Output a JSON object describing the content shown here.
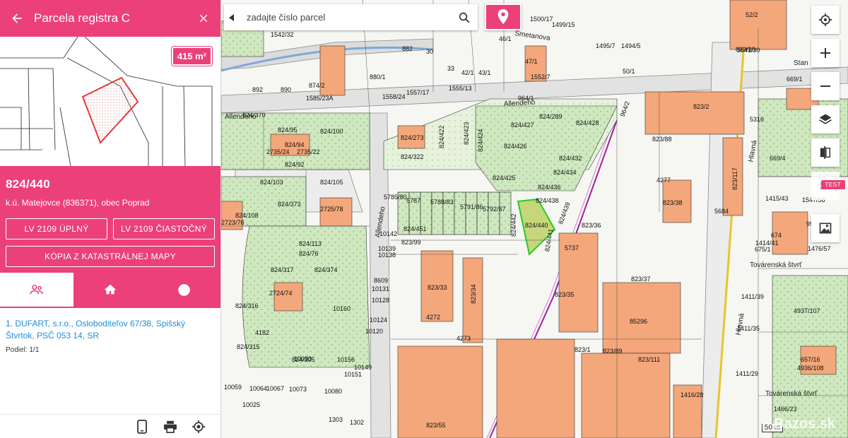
{
  "panel": {
    "title": "Parcela registra C",
    "area_badge": "415 m²",
    "parcel_id": "824/440",
    "parcel_sub": "k.ú. Matejovce (836371), obec Poprad",
    "buttons": {
      "lv_full": "LV 2109 ÚPLNÝ",
      "lv_partial": "LV 2109 ČIASTOČNÝ",
      "copy_map": "KÓPIA Z KATASTRÁLNEJ MAPY"
    },
    "tabs": [
      {
        "icon": "owners-icon"
      },
      {
        "icon": "home-icon"
      },
      {
        "icon": "info-icon"
      }
    ],
    "owner": {
      "text": "1. DUFART, s.r.o., Osloboditeľov 67/38, Spišský Štvrtok, PSČ 053 14, SR",
      "share": "Podiel: 1/1"
    },
    "footer_icons": [
      "phone-icon",
      "print-icon",
      "target-icon"
    ]
  },
  "search": {
    "placeholder": "zadajte číslo parcel"
  },
  "map": {
    "controls": {
      "three_d": "3D",
      "test": "TEST"
    },
    "scale": "50 m",
    "watermark": "Bazos.sk",
    "streets": {
      "allendeho_1": "Allendeho",
      "allendeho_2": "Allendeho",
      "allendeho_3": "Allendeho",
      "smetanova": "Smetanova",
      "hlavna_1": "Hlavná",
      "hlavna_2": "Hlavná",
      "tovarenska_1": "Továrenská štvrť",
      "tovarenska_2": "Továrenská štvrť",
      "stan": "Stan"
    },
    "parcel_labels": [
      {
        "t": "824/440"
      },
      {
        "t": "824/438"
      },
      {
        "t": "824/436"
      },
      {
        "t": "824/434"
      },
      {
        "t": "824/432"
      },
      {
        "t": "824/428"
      },
      {
        "t": "824/427"
      },
      {
        "t": "824/426"
      },
      {
        "t": "824/425"
      },
      {
        "t": "824/424"
      },
      {
        "t": "824/423"
      },
      {
        "t": "824/422"
      },
      {
        "t": "824/289"
      },
      {
        "t": "824/273"
      },
      {
        "t": "824/322"
      },
      {
        "t": "824/442"
      },
      {
        "t": "824/441"
      },
      {
        "t": "824/451"
      },
      {
        "t": "824/439"
      },
      {
        "t": "823/36"
      },
      {
        "t": "823/35"
      },
      {
        "t": "823/37"
      },
      {
        "t": "823/33"
      },
      {
        "t": "823/34"
      },
      {
        "t": "823/99"
      },
      {
        "t": "823/38"
      },
      {
        "t": "823/2"
      },
      {
        "t": "823/88"
      },
      {
        "t": "823/117"
      },
      {
        "t": "823/1"
      },
      {
        "t": "823/89"
      },
      {
        "t": "823/111"
      },
      {
        "t": "823/55"
      },
      {
        "t": "823/30"
      },
      {
        "t": "824/370"
      },
      {
        "t": "824/95"
      },
      {
        "t": "824/100"
      },
      {
        "t": "824/94"
      },
      {
        "t": "824/92"
      },
      {
        "t": "824/103"
      },
      {
        "t": "824/105"
      },
      {
        "t": "824/373"
      },
      {
        "t": "824/108"
      },
      {
        "t": "824/113"
      },
      {
        "t": "824/76"
      },
      {
        "t": "824/317"
      },
      {
        "t": "824/374"
      },
      {
        "t": "824/316"
      },
      {
        "t": "824/315"
      },
      {
        "t": "824/305"
      },
      {
        "t": "5785/80"
      },
      {
        "t": "5787"
      },
      {
        "t": "5788/83"
      },
      {
        "t": "5791/86"
      },
      {
        "t": "5792/87"
      },
      {
        "t": "2725/78"
      },
      {
        "t": "2724/74"
      },
      {
        "t": "2723/76"
      },
      {
        "t": "2735/24"
      },
      {
        "t": "2735/22"
      },
      {
        "t": "4272"
      },
      {
        "t": "4273"
      },
      {
        "t": "4277"
      },
      {
        "t": "4182"
      },
      {
        "t": "5737"
      },
      {
        "t": "5684"
      },
      {
        "t": "5316"
      },
      {
        "t": "85296"
      },
      {
        "t": "964/1"
      },
      {
        "t": "964/2"
      },
      {
        "t": "50/1"
      },
      {
        "t": "47/1"
      },
      {
        "t": "46/1"
      },
      {
        "t": "43/1"
      },
      {
        "t": "42/1"
      },
      {
        "t": "33"
      },
      {
        "t": "30"
      },
      {
        "t": "882"
      },
      {
        "t": "880/1"
      },
      {
        "t": "892"
      },
      {
        "t": "890"
      },
      {
        "t": "1552/7"
      },
      {
        "t": "1555/13"
      },
      {
        "t": "1557/17"
      },
      {
        "t": "1558/24"
      },
      {
        "t": "1585/23A"
      },
      {
        "t": "874/2"
      },
      {
        "t": "52/2"
      },
      {
        "t": "3641/30"
      },
      {
        "t": "669/1"
      },
      {
        "t": "669/4"
      },
      {
        "t": "674"
      },
      {
        "t": "1415/43"
      },
      {
        "t": "1414/41"
      },
      {
        "t": "4937/107"
      },
      {
        "t": "4936/108"
      },
      {
        "t": "657/16"
      },
      {
        "t": "1466/23"
      },
      {
        "t": "1416/28"
      },
      {
        "t": "1411/39"
      },
      {
        "t": "1411/35"
      },
      {
        "t": "1411/29"
      },
      {
        "t": "10142"
      },
      {
        "t": "10139"
      },
      {
        "t": "10138"
      },
      {
        "t": "10131"
      },
      {
        "t": "10128"
      },
      {
        "t": "10124"
      },
      {
        "t": "10120"
      },
      {
        "t": "10160"
      },
      {
        "t": "10156"
      },
      {
        "t": "10151"
      },
      {
        "t": "10149"
      },
      {
        "t": "10093"
      },
      {
        "t": "10059"
      },
      {
        "t": "10064"
      },
      {
        "t": "10067"
      },
      {
        "t": "10073"
      },
      {
        "t": "10080"
      },
      {
        "t": "10025"
      },
      {
        "t": "1303"
      },
      {
        "t": "1302"
      },
      {
        "t": "8609"
      },
      {
        "t": "1500/17"
      },
      {
        "t": "1499/15"
      },
      {
        "t": "1495/7"
      },
      {
        "t": "1494/5"
      },
      {
        "t": "1542/32"
      },
      {
        "t": "1547/58"
      },
      {
        "t": "9946"
      },
      {
        "t": "1476/57"
      },
      {
        "t": "675/1"
      }
    ]
  }
}
